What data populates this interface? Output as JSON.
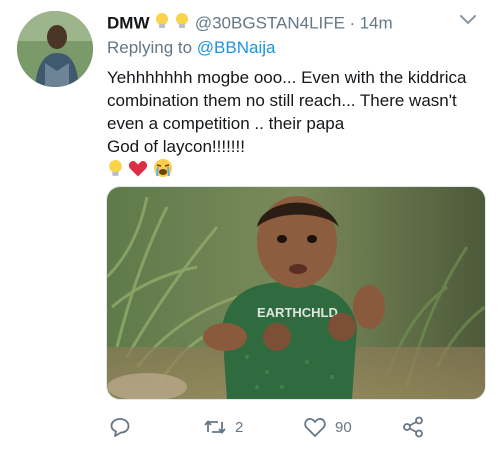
{
  "tweet": {
    "display_name": "DMW",
    "handle": "@30BGSTAN4LIFE",
    "separator": "·",
    "time": "14m",
    "replying_prefix": "Replying to ",
    "replying_to": "@BBNaija",
    "text_lines": [
      "Yehhhhhhh mogbe ooo... Even with the kiddrica",
      "combination them no still reach... There wasn't",
      "even a competition .. their papa",
      "God of laycon!!!!!!!"
    ],
    "name_emojis": [
      "lightbulb-emoji",
      "lightbulb-emoji"
    ],
    "tail_emojis": [
      "lightbulb-emoji",
      "red-heart-emoji",
      "crying-face-emoji"
    ],
    "media": {
      "description_icon": "photo",
      "shirt_text": "EARTHCHLD"
    }
  },
  "actions": {
    "reply_icon": "reply-icon",
    "retweet_icon": "retweet-icon",
    "retweet_count": "2",
    "like_icon": "heart-outline-icon",
    "like_count": "90",
    "share_icon": "share-icon"
  },
  "colors": {
    "link": "#1b95e0",
    "muted": "#657786",
    "text": "#14171a"
  }
}
